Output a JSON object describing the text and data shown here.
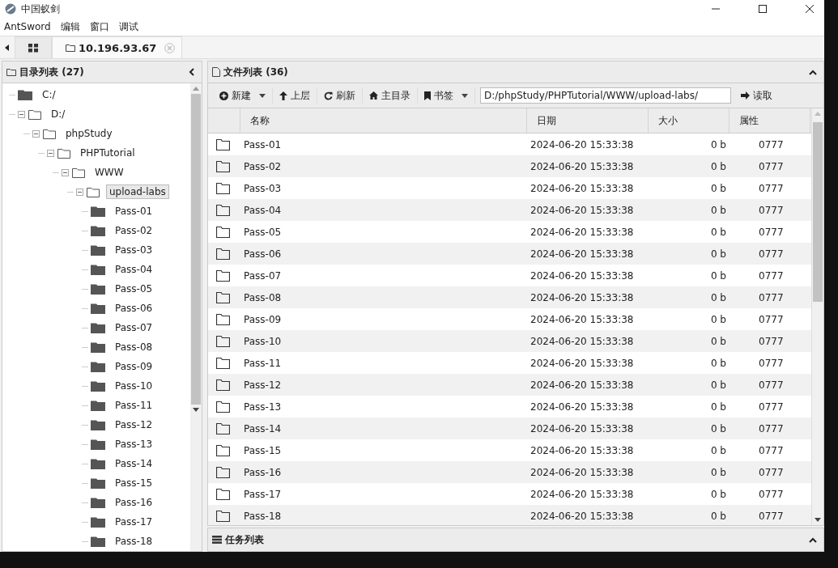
{
  "window": {
    "title": "中国蚁剑"
  },
  "menu": [
    "AntSword",
    "编辑",
    "窗口",
    "调试"
  ],
  "tabs": [
    {
      "kind": "home",
      "selected": false
    },
    {
      "kind": "shell",
      "label": "10.196.93.67",
      "selected": true
    }
  ],
  "tree_panel": {
    "title": "目录列表 (27)",
    "nodes": [
      {
        "label": "C:/",
        "expanded": false,
        "selected": false
      },
      {
        "label": "D:/",
        "expanded": true,
        "selected": false,
        "children": [
          {
            "label": "phpStudy",
            "expanded": true,
            "selected": false,
            "children": [
              {
                "label": "PHPTutorial",
                "expanded": true,
                "selected": false,
                "children": [
                  {
                    "label": "WWW",
                    "expanded": true,
                    "selected": false,
                    "children": [
                      {
                        "label": "upload-labs",
                        "expanded": true,
                        "selected": true,
                        "children": [
                          {
                            "label": "Pass-01",
                            "expanded": false,
                            "selected": false
                          },
                          {
                            "label": "Pass-02",
                            "expanded": false,
                            "selected": false
                          },
                          {
                            "label": "Pass-03",
                            "expanded": false,
                            "selected": false
                          },
                          {
                            "label": "Pass-04",
                            "expanded": false,
                            "selected": false
                          },
                          {
                            "label": "Pass-05",
                            "expanded": false,
                            "selected": false
                          },
                          {
                            "label": "Pass-06",
                            "expanded": false,
                            "selected": false
                          },
                          {
                            "label": "Pass-07",
                            "expanded": false,
                            "selected": false
                          },
                          {
                            "label": "Pass-08",
                            "expanded": false,
                            "selected": false
                          },
                          {
                            "label": "Pass-09",
                            "expanded": false,
                            "selected": false
                          },
                          {
                            "label": "Pass-10",
                            "expanded": false,
                            "selected": false
                          },
                          {
                            "label": "Pass-11",
                            "expanded": false,
                            "selected": false
                          },
                          {
                            "label": "Pass-12",
                            "expanded": false,
                            "selected": false
                          },
                          {
                            "label": "Pass-13",
                            "expanded": false,
                            "selected": false
                          },
                          {
                            "label": "Pass-14",
                            "expanded": false,
                            "selected": false
                          },
                          {
                            "label": "Pass-15",
                            "expanded": false,
                            "selected": false
                          },
                          {
                            "label": "Pass-16",
                            "expanded": false,
                            "selected": false
                          },
                          {
                            "label": "Pass-17",
                            "expanded": false,
                            "selected": false
                          },
                          {
                            "label": "Pass-18",
                            "expanded": false,
                            "selected": false
                          }
                        ]
                      }
                    ]
                  }
                ]
              }
            ]
          }
        ]
      }
    ]
  },
  "file_panel": {
    "title": "文件列表 (36)",
    "toolbar": [
      {
        "kind": "new",
        "label": "新建",
        "dropdown": true
      },
      {
        "kind": "up",
        "label": "上层",
        "dropdown": false
      },
      {
        "kind": "refresh",
        "label": "刷新",
        "dropdown": false
      },
      {
        "kind": "home",
        "label": "主目录",
        "dropdown": false
      },
      {
        "kind": "bookmark",
        "label": "书签",
        "dropdown": true
      }
    ],
    "path": "D:/phpStudy/PHPTutorial/WWW/upload-labs/",
    "read_button": "读取",
    "columns": [
      "名称",
      "日期",
      "大小",
      "属性"
    ],
    "rows": [
      {
        "name": "Pass-01",
        "date": "2024-06-20 15:33:38",
        "size": "0 b",
        "attr": "0777"
      },
      {
        "name": "Pass-02",
        "date": "2024-06-20 15:33:38",
        "size": "0 b",
        "attr": "0777"
      },
      {
        "name": "Pass-03",
        "date": "2024-06-20 15:33:38",
        "size": "0 b",
        "attr": "0777"
      },
      {
        "name": "Pass-04",
        "date": "2024-06-20 15:33:38",
        "size": "0 b",
        "attr": "0777"
      },
      {
        "name": "Pass-05",
        "date": "2024-06-20 15:33:38",
        "size": "0 b",
        "attr": "0777"
      },
      {
        "name": "Pass-06",
        "date": "2024-06-20 15:33:38",
        "size": "0 b",
        "attr": "0777"
      },
      {
        "name": "Pass-07",
        "date": "2024-06-20 15:33:38",
        "size": "0 b",
        "attr": "0777"
      },
      {
        "name": "Pass-08",
        "date": "2024-06-20 15:33:38",
        "size": "0 b",
        "attr": "0777"
      },
      {
        "name": "Pass-09",
        "date": "2024-06-20 15:33:38",
        "size": "0 b",
        "attr": "0777"
      },
      {
        "name": "Pass-10",
        "date": "2024-06-20 15:33:38",
        "size": "0 b",
        "attr": "0777"
      },
      {
        "name": "Pass-11",
        "date": "2024-06-20 15:33:38",
        "size": "0 b",
        "attr": "0777"
      },
      {
        "name": "Pass-12",
        "date": "2024-06-20 15:33:38",
        "size": "0 b",
        "attr": "0777"
      },
      {
        "name": "Pass-13",
        "date": "2024-06-20 15:33:38",
        "size": "0 b",
        "attr": "0777"
      },
      {
        "name": "Pass-14",
        "date": "2024-06-20 15:33:38",
        "size": "0 b",
        "attr": "0777"
      },
      {
        "name": "Pass-15",
        "date": "2024-06-20 15:33:38",
        "size": "0 b",
        "attr": "0777"
      },
      {
        "name": "Pass-16",
        "date": "2024-06-20 15:33:38",
        "size": "0 b",
        "attr": "0777"
      },
      {
        "name": "Pass-17",
        "date": "2024-06-20 15:33:38",
        "size": "0 b",
        "attr": "0777"
      },
      {
        "name": "Pass-18",
        "date": "2024-06-20 15:33:38",
        "size": "0 b",
        "attr": "0777"
      }
    ]
  },
  "task_panel": {
    "title": "任务列表"
  }
}
